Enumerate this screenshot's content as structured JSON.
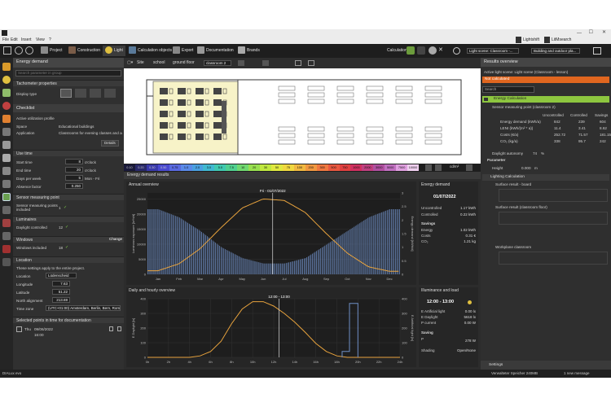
{
  "window": {
    "min": "—",
    "max": "☐",
    "close": "✕"
  },
  "menu": [
    "File",
    "Edit",
    "Insert",
    "View",
    "?"
  ],
  "account": {
    "app": "Lightshift",
    "user": "LitMsearch"
  },
  "toolbar": {
    "tabs": [
      "Project",
      "Construction",
      "Light",
      "Calculation objects",
      "Export",
      "Documentation",
      "Brands"
    ],
    "calculation": "Calculation",
    "scene": "Light scene: Classroom -...",
    "outdoor": "Building and outdoor pla..."
  },
  "viewbar": {
    "site": "Site",
    "school": "school",
    "floor": "ground floor",
    "room": "classroom 2"
  },
  "left": {
    "title": "Energy demand",
    "search_ph": "Search parameter in group",
    "tacho": "Tachometer properties",
    "display_type": "Display type",
    "checklist": "Checklist",
    "profile": "Active utilization profile",
    "space_l": "Space",
    "space_v": "Educational buildings",
    "app_l": "Application",
    "app_v": "Classrooms for evening classes and ad...",
    "details": "Details",
    "use_time": "Use time",
    "start_l": "Start time",
    "start_v": "8",
    "start_u": "o'clock",
    "end_l": "End time",
    "end_v": "20",
    "end_u": "o'clock",
    "days_l": "Days per week",
    "days_v": "5",
    "days_u": "Mon - Fri",
    "abs_l": "Absence factor",
    "abs_v": "0.250",
    "smp": "Sensor measuring point",
    "smp_l": "Sensor measuring points included",
    "smp_v": "1",
    "lum": "Luminaires",
    "dc_l": "Daylight controlled",
    "dc_v": "12",
    "win": "Windows",
    "change": "Change",
    "win_l": "Windows included",
    "win_v": "18",
    "loc": "Location",
    "loc_note": "These settings apply to the entire project.",
    "loc_l": "Location",
    "loc_v": "Lüdenscheid",
    "lon_l": "Longitude",
    "lon_v": "7.63",
    "lat_l": "Latitude",
    "lat_v": "51.22",
    "north_l": "North alignment",
    "north_v": "213.69",
    "tz_l": "Time zone",
    "tz_v": "(UTC+01:00) Amsterdam, Berlin, Bern, Rom...",
    "sel": "Selected points in time for documentation",
    "sel_day": "Thu",
    "sel_date": "09/06/2022",
    "sel_time": "16:00"
  },
  "scale": [
    "0.10",
    "0.20",
    "0.30",
    "0.50",
    "0.75",
    "1.0",
    "2.0",
    "3.0",
    "5.0",
    "7.5",
    "10",
    "20",
    "30",
    "50",
    "75",
    "100",
    "200",
    "300",
    "500",
    "750",
    "1000",
    "2000",
    "3000",
    "5000",
    "7500",
    "10000"
  ],
  "scale_unit": "cd/m²",
  "results_header": "Energy demand results",
  "annual": {
    "title": "Annual overview",
    "date": "Fri - 01/07/2022",
    "yleft": "Luminous exposure [lx*h/d]",
    "yright": "Energy demand [kWh/d]",
    "months": [
      "Jan",
      "Feb",
      "Mar",
      "Apr",
      "May",
      "Jun",
      "Jul",
      "Aug",
      "Sep",
      "Oct",
      "Nov",
      "Dec"
    ],
    "yticks": [
      "0",
      "5000",
      "10000",
      "15000",
      "20000",
      "25000"
    ],
    "rticks": [
      "0",
      "0.5",
      "1",
      "1.5",
      "2",
      "2.5",
      "3"
    ]
  },
  "daily": {
    "title": "Daily and hourly overview",
    "time": "12:00 - 13:00",
    "yleft": "E Daylight [lx]",
    "yright": "E Artificial light [lx]",
    "hours": [
      "0h",
      "2h",
      "4h",
      "6h",
      "8h",
      "10h",
      "12h",
      "14h",
      "16h",
      "18h",
      "20h",
      "22h",
      "24h"
    ],
    "yticks": [
      "0",
      "100",
      "200",
      "300",
      "400"
    ]
  },
  "chart_data": [
    {
      "type": "bar",
      "title": "Annual overview",
      "annotation": "Fri - 01/07/2022",
      "xlabel": "",
      "ylabel": "Luminous exposure [lx*h/d]",
      "categories": [
        "Jan",
        "Feb",
        "Mar",
        "Apr",
        "May",
        "Jun",
        "Jul",
        "Aug",
        "Sep",
        "Oct",
        "Nov",
        "Dec"
      ],
      "series": [
        {
          "name": "Energy demand [kWh/d]",
          "type": "bar",
          "values": [
            2.4,
            2.1,
            1.6,
            1.0,
            0.6,
            0.4,
            0.4,
            0.6,
            1.1,
            1.6,
            2.1,
            2.4
          ]
        },
        {
          "name": "Luminous exposure [lx*h/d]",
          "type": "line",
          "values": [
            1200,
            3500,
            8500,
            15500,
            22000,
            25000,
            24500,
            20500,
            13500,
            7000,
            2500,
            1000
          ]
        }
      ],
      "ylim": [
        0,
        27000
      ],
      "y2lim": [
        0,
        3
      ]
    },
    {
      "type": "line",
      "title": "Daily and hourly overview",
      "annotation": "12:00 - 13:00",
      "xlabel": "",
      "ylabel": "E Daylight [lx]",
      "x": [
        0,
        2,
        4,
        5,
        6,
        7,
        8,
        9,
        10,
        11,
        12,
        13,
        14,
        15,
        16,
        17,
        18,
        19,
        20,
        22,
        24
      ],
      "series": [
        {
          "name": "E Daylight [lx]",
          "values": [
            0,
            0,
            0,
            10,
            40,
            110,
            230,
            330,
            380,
            380,
            350,
            300,
            240,
            170,
            95,
            40,
            10,
            0,
            0,
            0,
            0
          ]
        },
        {
          "name": "E Artificial light [lx]",
          "values": [
            0,
            0,
            0,
            0,
            0,
            0,
            0,
            0,
            0,
            0,
            0,
            0,
            0,
            0,
            0,
            0,
            0,
            0,
            0,
            0,
            0
          ]
        }
      ],
      "ylim": [
        0,
        400
      ],
      "xlim": [
        0,
        24
      ]
    }
  ],
  "energy": {
    "title": "Energy demand",
    "date": "01/07/2022",
    "uncontrolled_l": "Uncontrolled",
    "uncontrolled_v": "1.17 kWh",
    "controlled_l": "Controlled",
    "controlled_v": "0.22 kWh",
    "savings_h": "Savings",
    "en_l": "Energy",
    "en_v": "1.02 kWh",
    "cost_l": "Costs",
    "cost_v": "0.31 €",
    "co2_l": "CO₂",
    "co2_v": "1.21 kg"
  },
  "illum": {
    "title": "Illuminance and load",
    "time": "12:00 - 13:00",
    "ea_l": "E Artificial light",
    "ea_v": "0.00 lx",
    "ed_l": "E Daylight",
    "ed_v": "5618 lx",
    "pc_l": "P current",
    "pc_v": "0.00 W",
    "sav_h": "Saving",
    "p_l": "P",
    "p_v": "278 W",
    "sh_l": "Shading",
    "sh_v": "Open/None"
  },
  "right": {
    "title": "Results overview",
    "active": "Active light scene: Light scene (Classroom - lesson)",
    "notcalc": "Not calculated",
    "search_ph": "Search",
    "energy_calc": "Energy Calculation",
    "smp": "Sensor measuring point (classroom 2)",
    "cols": [
      "Uncontrolled",
      "Controlled",
      "Savings"
    ],
    "rows": [
      {
        "l": "Energy demand (kWh/a)",
        "u": "842",
        "c": "239",
        "s": "604"
      },
      {
        "l": "LENI (kWh/(m² * a))",
        "u": "11.4",
        "c": "3.41",
        "s": "8.62"
      },
      {
        "l": "Costs (€/a)",
        "u": "252.72",
        "c": "71.57",
        "s": "181.15"
      },
      {
        "l": "CO₂ (kg/a)",
        "u": "338",
        "c": "95.7",
        "s": "242"
      }
    ],
    "autonomy_l": "Daylight autonomy",
    "autonomy_v": "74",
    "autonomy_u": "%",
    "param": "Parameter",
    "height_l": "Height",
    "height_v": "0.000",
    "height_u": "m",
    "lighting_calc": "Lighting Calculation",
    "s1": "Surface result - board",
    "s2": "Surface result (classroom floor)",
    "s3": "Workplane classroom",
    "settings": "Settings"
  },
  "status": {
    "left": "DIALux evo",
    "mem": "Verwalteter Speicher 240MB",
    "msg": "1 new message"
  },
  "colors": {
    "bg": "#2b2b2b",
    "accent": "#8dc63f",
    "orange": "#e8a33d",
    "bars": "#6f8fc6",
    "notcalc": "#e0661f"
  }
}
